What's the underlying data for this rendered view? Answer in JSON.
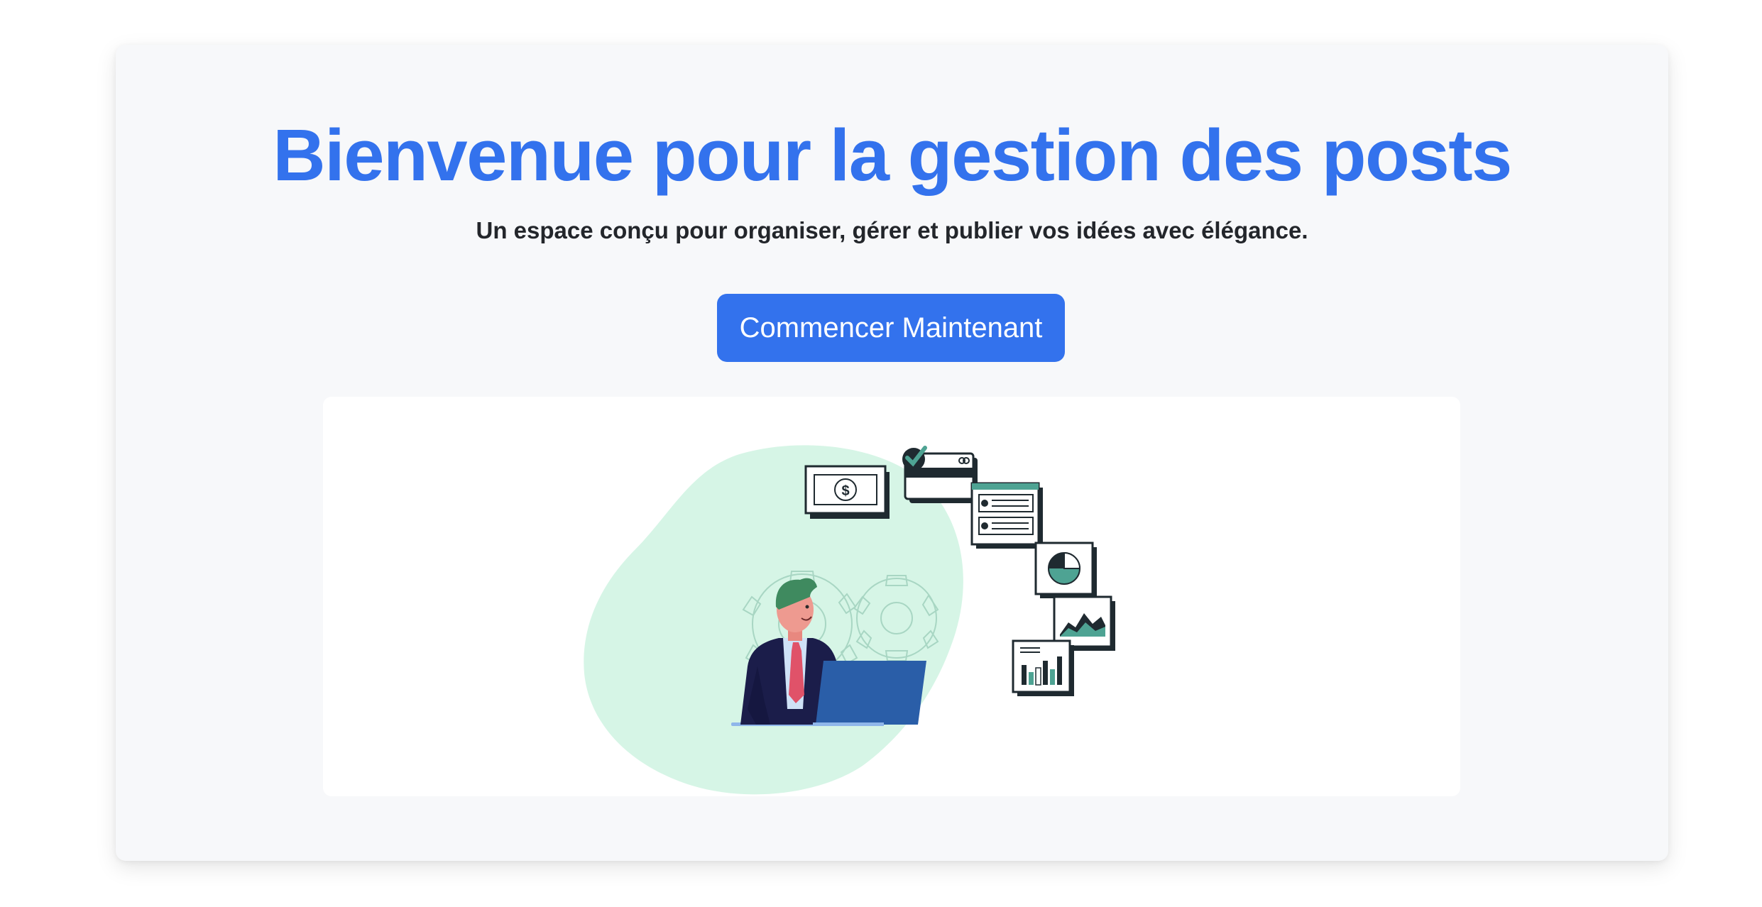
{
  "hero": {
    "title": "Bienvenue pour la gestion des posts",
    "subtitle": "Un espace conçu pour organiser, gérer et publier vos idées avec élégance.",
    "cta_label": "Commencer Maintenant"
  },
  "illustration": {
    "name": "business-analytics-illustration",
    "money_symbol": "$"
  },
  "colors": {
    "accent": "#3372ed",
    "card_background": "#f7f8fa",
    "blob": "#d6f5e6",
    "teal": "#4ea393",
    "navy": "#1b1d4a",
    "laptop": "#2a5ea8"
  }
}
